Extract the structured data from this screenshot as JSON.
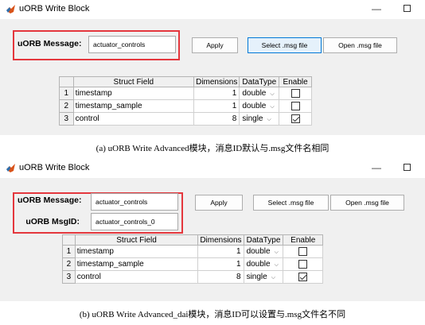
{
  "panels": {
    "a": {
      "title": "uORB Write Block",
      "minimize": "—",
      "message_label": "uORB Message:",
      "message_value": "actuator_controls",
      "buttons": {
        "apply": "Apply",
        "select": "Select .msg file",
        "open": "Open .msg file"
      },
      "table": {
        "headers": [
          "Struct Field",
          "Dimensions",
          "DataType",
          "Enable"
        ],
        "rows": [
          {
            "num": "1",
            "field": "timestamp",
            "dims": "1",
            "dtype": "double",
            "enabled": false
          },
          {
            "num": "2",
            "field": "timestamp_sample",
            "dims": "1",
            "dtype": "double",
            "enabled": false
          },
          {
            "num": "3",
            "field": "control",
            "dims": "8",
            "dtype": "single",
            "enabled": true
          }
        ]
      },
      "caption": "(a) uORB Write Advanced模块，消息ID默认与.msg文件名相同"
    },
    "b": {
      "title": "uORB Write Block",
      "minimize": "—",
      "message_label": "uORB Message:",
      "message_value": "actuator_controls",
      "msgid_label": "uORB MsgID:",
      "msgid_value": "actuator_controls_0",
      "buttons": {
        "apply": "Apply",
        "select": "Select .msg file",
        "open": "Open .msg file"
      },
      "table": {
        "headers": [
          "Struct Field",
          "Dimensions",
          "DataType",
          "Enable"
        ],
        "rows": [
          {
            "num": "1",
            "field": "timestamp",
            "dims": "1",
            "dtype": "double",
            "enabled": false
          },
          {
            "num": "2",
            "field": "timestamp_sample",
            "dims": "1",
            "dtype": "double",
            "enabled": false
          },
          {
            "num": "3",
            "field": "control",
            "dims": "8",
            "dtype": "single",
            "enabled": true
          }
        ]
      },
      "caption": "(b) uORB Write Advanced_dai模块，消息ID可以设置与.msg文件名不同"
    }
  },
  "icons": {
    "app": "matlab-logo-icon",
    "dropdown": "chevron-down-icon",
    "checkbox": "checkbox-icon"
  },
  "colors": {
    "highlight_border": "#e4373d",
    "focused_button": "#0078d7"
  }
}
